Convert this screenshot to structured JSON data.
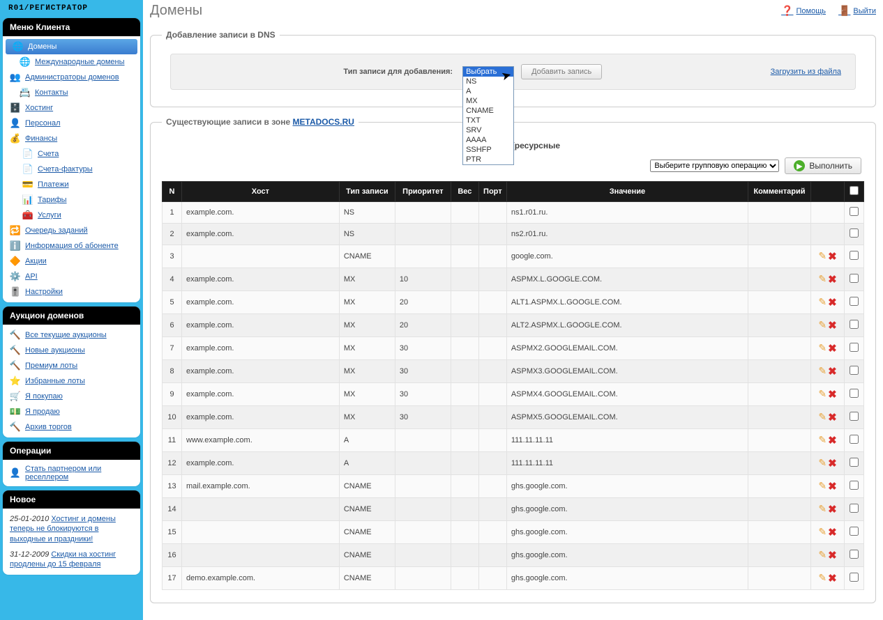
{
  "brand": "R01/РЕГИСТРАТОР",
  "top": {
    "title": "Домены",
    "help": "Помощь",
    "logout": "Выйти"
  },
  "sidebar": {
    "menus": [
      {
        "title": "Меню Клиента",
        "items": [
          {
            "label": "Домены",
            "icon": "🌐",
            "active": true
          },
          {
            "label": "Международные домены",
            "icon": "🌐",
            "sub": true
          },
          {
            "label": "Администраторы доменов",
            "icon": "👥"
          },
          {
            "label": "Контакты",
            "icon": "📇",
            "sub": true
          },
          {
            "label": "Хостинг",
            "icon": "🗄️"
          },
          {
            "label": "Персонал",
            "icon": "👤"
          },
          {
            "label": "Финансы",
            "icon": "💰"
          },
          {
            "label": "Счета",
            "icon": "📄",
            "sub2": true
          },
          {
            "label": "Счета-фактуры",
            "icon": "📄",
            "sub2": true
          },
          {
            "label": "Платежи",
            "icon": "💳",
            "sub2": true
          },
          {
            "label": "Тарифы",
            "icon": "📊",
            "sub2": true
          },
          {
            "label": "Услуги",
            "icon": "🧰",
            "sub2": true
          },
          {
            "label": "Очередь заданий",
            "icon": "🔁"
          },
          {
            "label": "Информация об абоненте",
            "icon": "ℹ️"
          },
          {
            "label": "Акции",
            "icon": "🔶"
          },
          {
            "label": "API",
            "icon": "⚙️"
          },
          {
            "label": "Настройки",
            "icon": "🎚️"
          }
        ]
      },
      {
        "title": "Аукцион доменов",
        "items": [
          {
            "label": "Все текущие аукционы",
            "icon": "🔨"
          },
          {
            "label": "Новые аукционы",
            "icon": "🔨"
          },
          {
            "label": "Премиум лоты",
            "icon": "🔨"
          },
          {
            "label": "Избранные лоты",
            "icon": "⭐"
          },
          {
            "label": "Я покупаю",
            "icon": "🛒"
          },
          {
            "label": "Я продаю",
            "icon": "💵"
          },
          {
            "label": "Архив торгов",
            "icon": "🔨"
          }
        ]
      },
      {
        "title": "Операции",
        "items": [
          {
            "label": "Стать партнером или реселлером",
            "icon": "👤"
          }
        ]
      },
      {
        "title": "Новое",
        "news": [
          {
            "date": "25-01-2010",
            "text": "Хостинг и домены теперь не блокируются в выходные и праздники!"
          },
          {
            "date": "31-12-2009",
            "text": "Скидки на хостинг продлены до 15 февраля"
          }
        ]
      }
    ]
  },
  "addDns": {
    "legend": "Добавление записи в DNS",
    "label": "Тип записи для добавления:",
    "selectPlaceholder": "Выбрать",
    "options": [
      "Выбрать",
      "NS",
      "A",
      "MX",
      "CNAME",
      "TXT",
      "SRV",
      "AAAA",
      "SSHFP",
      "PTR"
    ],
    "addBtn": "Добавить запись",
    "uploadLink": "Загрузить из файла"
  },
  "zone": {
    "legendPrefix": "Существующие записи в зоне",
    "domain": "METADOCS.RU",
    "rrLabel": "RR-записи (ресурсные",
    "groupOpPlaceholder": "Выберите групповую операцию",
    "execute": "Выполнить",
    "columns": {
      "n": "N",
      "host": "Хост",
      "type": "Тип записи",
      "prio": "Приоритет",
      "weight": "Вес",
      "port": "Порт",
      "value": "Значение",
      "comment": "Комментарий"
    },
    "rows": [
      {
        "n": 1,
        "host": "example.com.",
        "type": "NS",
        "prio": "",
        "value": "ns1.r01.ru.",
        "act": false
      },
      {
        "n": 2,
        "host": "example.com.",
        "type": "NS",
        "prio": "",
        "value": "ns2.r01.ru.",
        "act": false
      },
      {
        "n": 3,
        "host": "",
        "type": "CNAME",
        "prio": "",
        "value": "google.com.",
        "act": true
      },
      {
        "n": 4,
        "host": "example.com.",
        "type": "MX",
        "prio": "10",
        "value": "ASPMX.L.GOOGLE.COM.",
        "act": true
      },
      {
        "n": 5,
        "host": "example.com.",
        "type": "MX",
        "prio": "20",
        "value": "ALT1.ASPMX.L.GOOGLE.COM.",
        "act": true
      },
      {
        "n": 6,
        "host": "example.com.",
        "type": "MX",
        "prio": "20",
        "value": "ALT2.ASPMX.L.GOOGLE.COM.",
        "act": true
      },
      {
        "n": 7,
        "host": "example.com.",
        "type": "MX",
        "prio": "30",
        "value": "ASPMX2.GOOGLEMAIL.COM.",
        "act": true
      },
      {
        "n": 8,
        "host": "example.com.",
        "type": "MX",
        "prio": "30",
        "value": "ASPMX3.GOOGLEMAIL.COM.",
        "act": true
      },
      {
        "n": 9,
        "host": "example.com.",
        "type": "MX",
        "prio": "30",
        "value": "ASPMX4.GOOGLEMAIL.COM.",
        "act": true
      },
      {
        "n": 10,
        "host": "example.com.",
        "type": "MX",
        "prio": "30",
        "value": "ASPMX5.GOOGLEMAIL.COM.",
        "act": true
      },
      {
        "n": 11,
        "host": "www.example.com.",
        "type": "A",
        "prio": "",
        "value": "111.11.11.11",
        "act": true
      },
      {
        "n": 12,
        "host": "example.com.",
        "type": "A",
        "prio": "",
        "value": "111.11.11.11",
        "act": true
      },
      {
        "n": 13,
        "host": "mail.example.com.",
        "type": "CNAME",
        "prio": "",
        "value": "ghs.google.com.",
        "act": true
      },
      {
        "n": 14,
        "host": "",
        "type": "CNAME",
        "prio": "",
        "value": "ghs.google.com.",
        "act": true
      },
      {
        "n": 15,
        "host": "",
        "type": "CNAME",
        "prio": "",
        "value": "ghs.google.com.",
        "act": true
      },
      {
        "n": 16,
        "host": "",
        "type": "CNAME",
        "prio": "",
        "value": "ghs.google.com.",
        "act": true
      },
      {
        "n": 17,
        "host": "demo.example.com.",
        "type": "CNAME",
        "prio": "",
        "value": "ghs.google.com.",
        "act": true
      }
    ]
  }
}
